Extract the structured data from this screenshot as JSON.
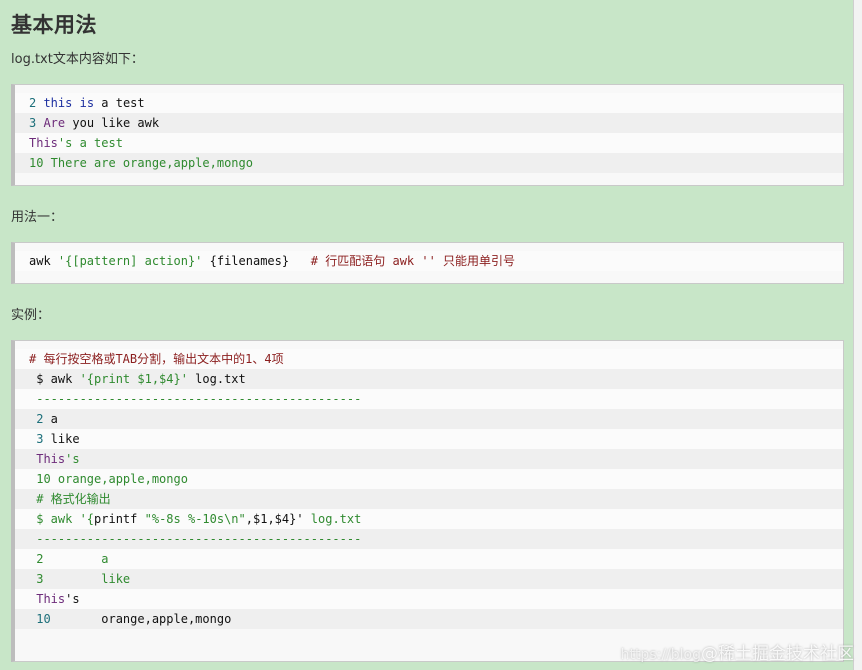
{
  "heading": "基本用法",
  "intro": "log.txt文本内容如下：",
  "block1": [
    [
      "2 ",
      "this",
      " ",
      "is",
      " a test"
    ],
    [
      "3 ",
      "Are",
      " you like awk"
    ],
    [
      "This",
      "'s a test"
    ],
    [
      "10 There are orange,apple,mongo"
    ]
  ],
  "usage_label": "用法一：",
  "block2": {
    "a": "awk ",
    "b": "'{[pattern] action}'",
    "c": " {",
    "d": "filenames",
    "e": "}",
    "f": "   # 行匹配语句 awk '' 只能用单引号"
  },
  "example_label": "实例：",
  "block3": {
    "l1": "# 每行按空格或TAB分割，输出文本中的1、4项",
    "l2a": " $ awk ",
    "l2b": "'{print $1,$4}'",
    "l2c": " log.txt",
    "l3": " ---------------------------------------------",
    "l4a": " 2",
    "l4b": " a",
    "l5a": " 3",
    "l5b": " like",
    "l6a": " This",
    "l6b": "'s",
    "l7": " 10 orange,apple,mongo",
    "l8": " # 格式化输出",
    "l9a": " $ awk ",
    "l9b": "'{",
    "l9c": "printf",
    "l9d": " \"%-8s %-10s\\n\"",
    "l9e": ",$1,$4}'",
    "l9f": " log.txt",
    "l10": " ---------------------------------------------",
    "l11a": " 2",
    "l11b": "        a",
    "l12a": " 3",
    "l12b": "        like",
    "l13a": " This",
    "l13b": "'s",
    "l14a": " 10",
    "l14b": "       orange,apple,mongo"
  },
  "watermark_url": "https://blog",
  "watermark_text": "@稀土掘金技术社区"
}
